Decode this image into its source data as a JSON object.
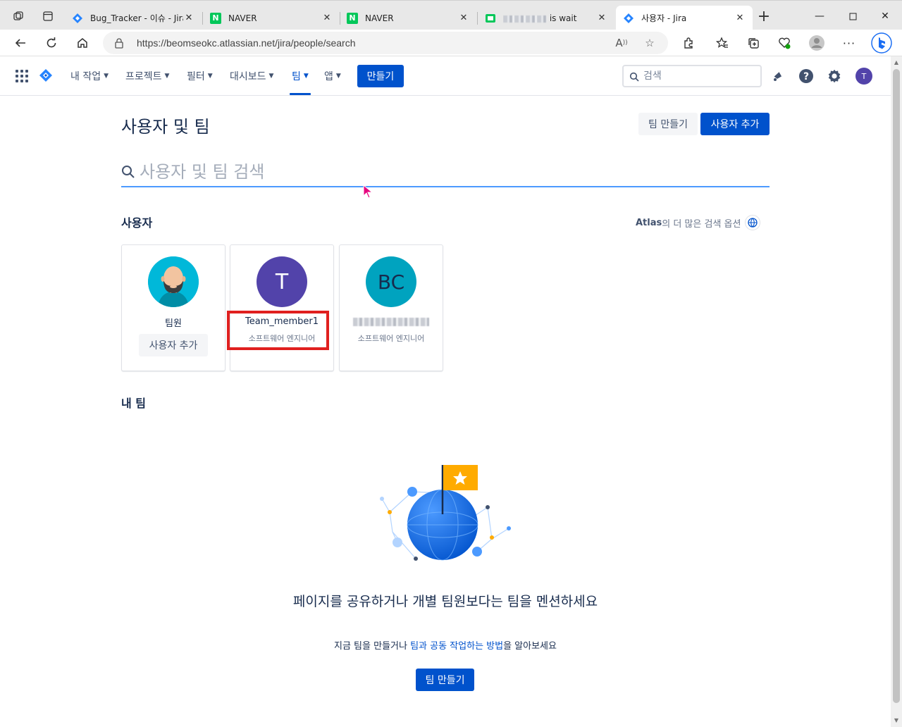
{
  "browser": {
    "tabs": [
      {
        "title": "Bug_Tracker - 이슈 - Jira",
        "favicon": "jira-icon"
      },
      {
        "title": "NAVER",
        "favicon": "naver-icon"
      },
      {
        "title": "NAVER",
        "favicon": "naver-icon"
      },
      {
        "title": "is wait",
        "favicon": "chat-icon"
      },
      {
        "title": "사용자 - Jira",
        "favicon": "jira-icon",
        "active": true
      }
    ],
    "new_tab_label": "+",
    "url": "https://beomseokc.atlassian.net/jira/people/search"
  },
  "jira_nav": {
    "menus": [
      {
        "label": "내 작업"
      },
      {
        "label": "프로젝트"
      },
      {
        "label": "필터"
      },
      {
        "label": "대시보드"
      },
      {
        "label": "팀",
        "active": true
      },
      {
        "label": "앱"
      }
    ],
    "create_label": "만들기",
    "search_placeholder": "검색",
    "profile_initial": "T"
  },
  "page": {
    "title": "사용자 및 팀",
    "create_team_label": "팀 만들기",
    "add_user_label": "사용자 추가",
    "search_placeholder": "사용자 및 팀 검색",
    "users_heading": "사용자",
    "atlas_brand": "Atlas",
    "atlas_text": "의 더 많은 검색 옵션",
    "users": [
      {
        "name": "팀원",
        "action_label": "사용자 추가"
      },
      {
        "name": "Team_member1",
        "role": "소프트웨어 엔지니어",
        "initials": "T",
        "color": "#5243AA"
      },
      {
        "role": "소프트웨어 엔지니어",
        "initials": "BC",
        "color": "#00A3BF"
      }
    ],
    "my_teams_heading": "내 팀",
    "empty_title": "페이지를 공유하거나 개별 팀원보다는 팀을 멘션하세요",
    "empty_desc_pre": "지금 팀을 만들거나 ",
    "empty_desc_link": "팀과 공동 작업하는 방법",
    "empty_desc_post": "을 알아보세요",
    "empty_button": "팀 만들기"
  },
  "colors": {
    "primary": "#0052CC",
    "highlight": "#E0201F",
    "naver": "#03C75A"
  }
}
